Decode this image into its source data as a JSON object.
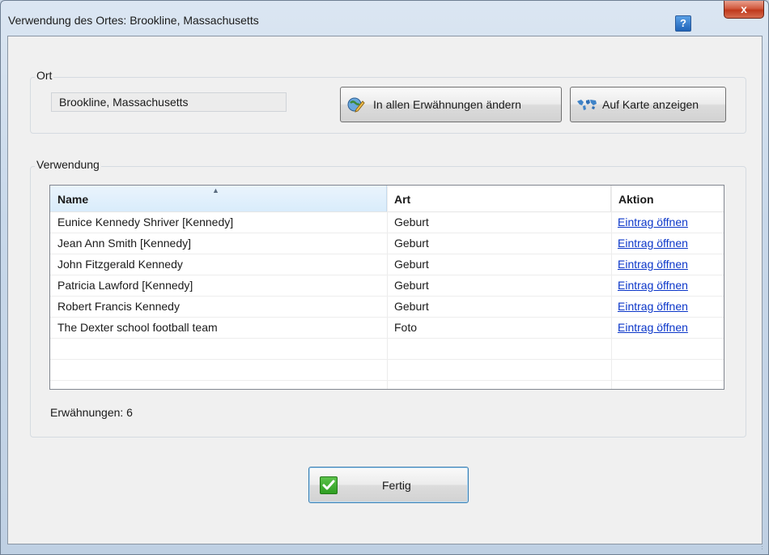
{
  "window": {
    "title": "Verwendung des Ortes: Brookline, Massachusetts",
    "help_label": "?",
    "close_label": "x"
  },
  "ort_group": {
    "label": "Ort",
    "place_value": "Brookline, Massachusetts",
    "change_all_button": {
      "label": "In allen Erwähnungen ändern",
      "icon": "edit-place-icon"
    },
    "map_button": {
      "label": "Auf Karte anzeigen",
      "icon": "world-map-icon"
    }
  },
  "usage_group": {
    "label": "Verwendung",
    "columns": [
      "Name",
      "Art",
      "Aktion"
    ],
    "sorted_column": "Name",
    "sort_direction": "ascending",
    "rows": [
      {
        "name": "Eunice Kennedy Shriver [Kennedy]",
        "type": "Geburt",
        "action": "Eintrag öffnen"
      },
      {
        "name": "Jean Ann Smith [Kennedy]",
        "type": "Geburt",
        "action": "Eintrag öffnen"
      },
      {
        "name": "John Fitzgerald Kennedy",
        "type": "Geburt",
        "action": "Eintrag öffnen"
      },
      {
        "name": "Patricia Lawford [Kennedy]",
        "type": "Geburt",
        "action": "Eintrag öffnen"
      },
      {
        "name": "Robert Francis Kennedy",
        "type": "Geburt",
        "action": "Eintrag öffnen"
      },
      {
        "name": "The Dexter school football team",
        "type": "Foto",
        "action": "Eintrag öffnen"
      }
    ],
    "mentions_text": "Erwähnungen: 6"
  },
  "footer": {
    "done_button": {
      "label": "Fertig",
      "icon": "checkmark-icon"
    }
  },
  "colors": {
    "link": "#0b36c9",
    "check_green": "#2f9e22",
    "close_red": "#c0391c"
  }
}
